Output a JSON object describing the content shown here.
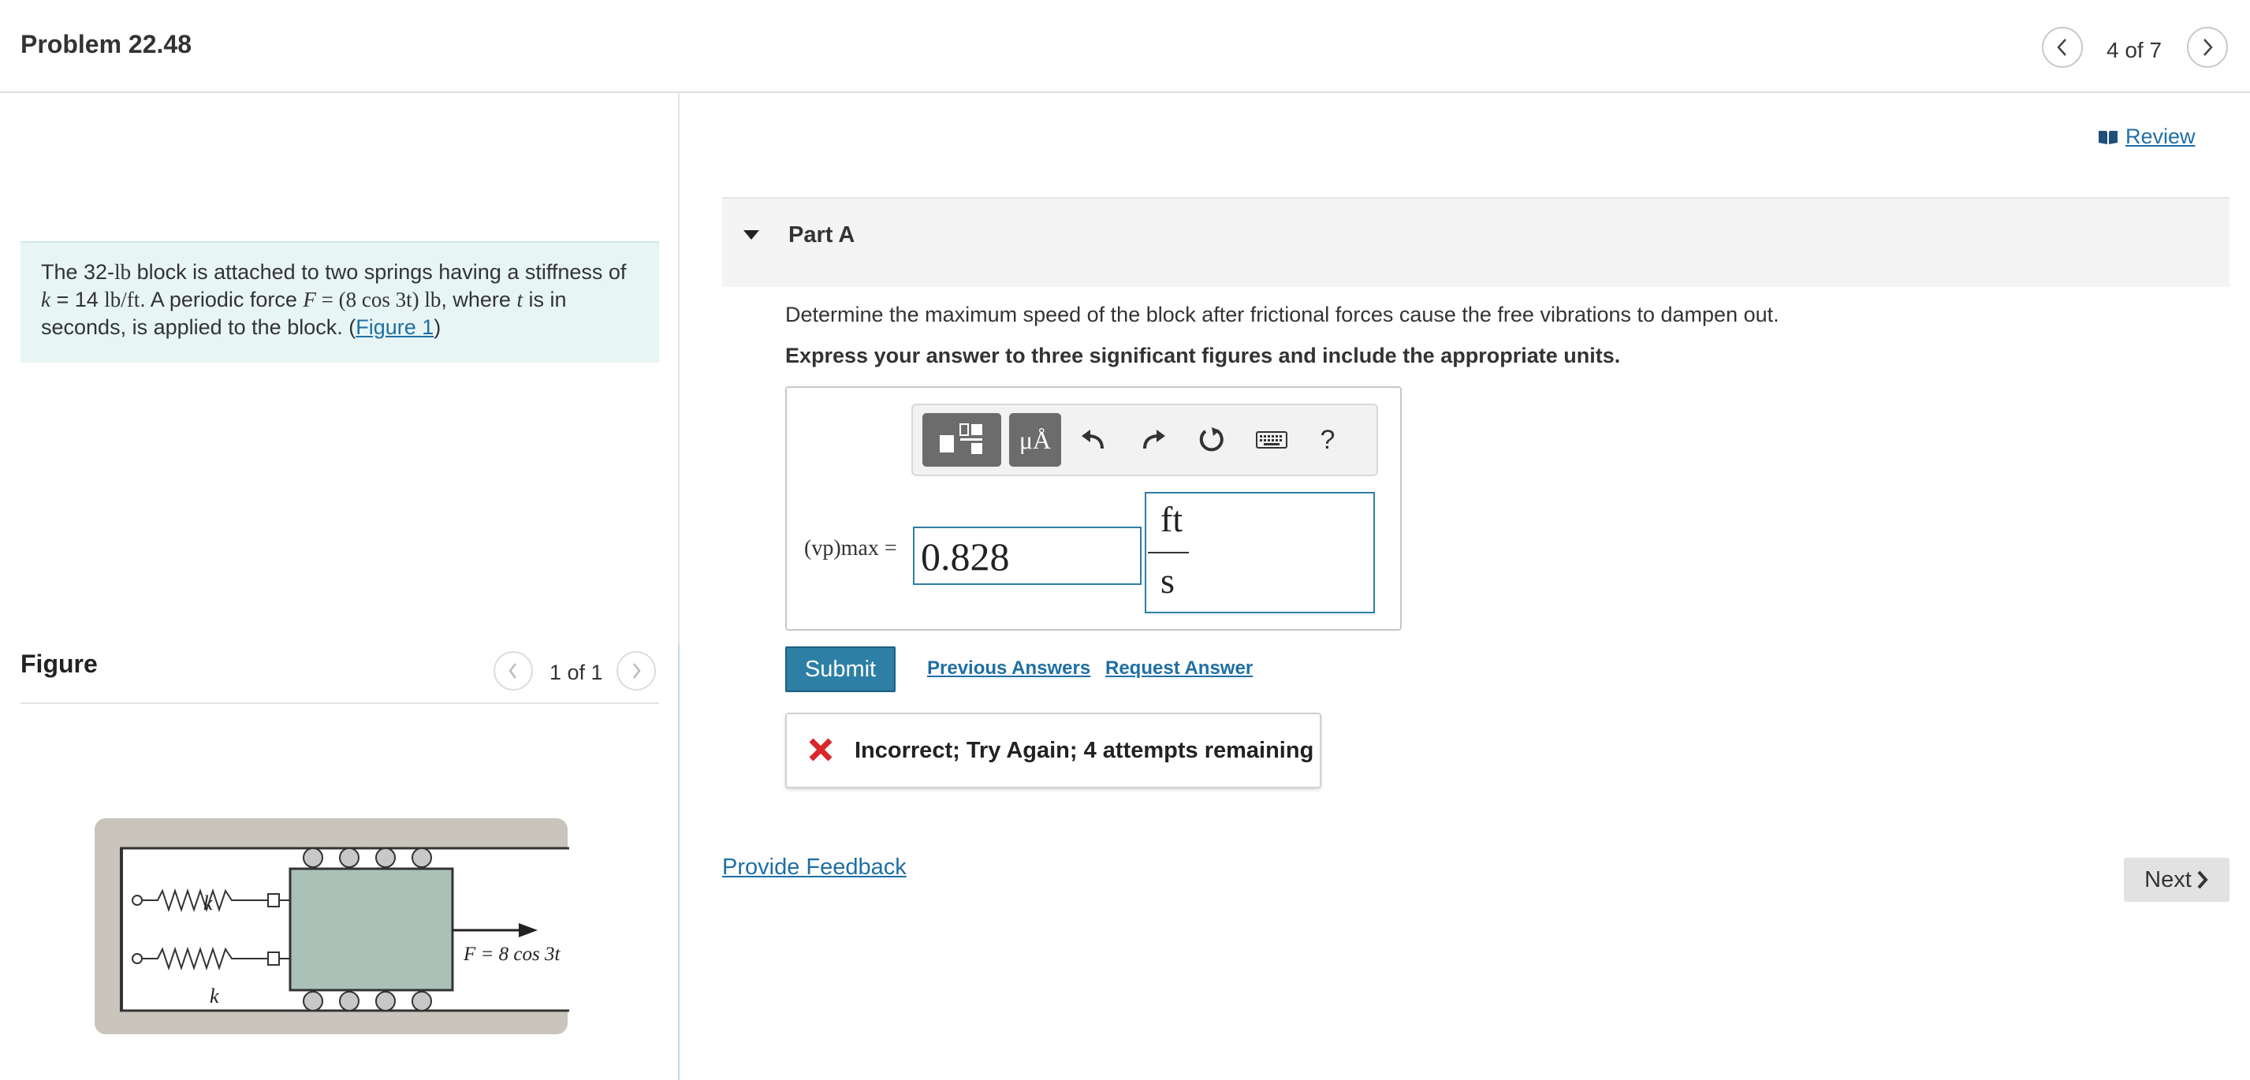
{
  "header": {
    "problem_title": "Problem 22.48",
    "nav_count": "4 of 7"
  },
  "intro": {
    "line1_pre": "The 32-",
    "line1_lb": "lb",
    "line1_post": " block is attached to two springs having a stiffness of",
    "line2_k": "k",
    "line2_eq": " = 14 ",
    "line2_units": "lb/ft",
    "line2_mid": ". A periodic force ",
    "line2_F": "F",
    "line2_expr": " = (8 cos 3t) lb",
    "line2_where": ", where ",
    "line2_t": "t",
    "line2_end": " is in",
    "line3_pre": "seconds, is applied to the block. (",
    "figure_link": "Figure 1",
    "line3_post": ")"
  },
  "figure": {
    "label": "Figure",
    "count": "1 of 1",
    "spring_label_top": "k",
    "spring_label_bottom": "k",
    "force_label": "F = 8 cos 3t"
  },
  "review": {
    "label": "Review"
  },
  "part_a": {
    "title": "Part A",
    "question": "Determine the maximum speed of the block after frictional forces cause the free vibrations to dampen out.",
    "instruction": "Express your answer to three significant figures and include the appropriate units.",
    "toolbar": {
      "units_glyph": "μÅ",
      "help_glyph": "?"
    },
    "variable_label": "(vp)max =",
    "answer_value": "0.828",
    "unit_numerator": "ft",
    "unit_denominator": "s",
    "submit_label": "Submit",
    "previous_answers": "Previous Answers",
    "request_answer": "Request Answer",
    "feedback": "Incorrect; Try Again; 4 attempts remaining"
  },
  "footer": {
    "provide_feedback": "Provide Feedback",
    "next_label": "Next"
  },
  "colors": {
    "accent": "#2d7fa6",
    "link": "#1f6fa5",
    "error": "#d9262b",
    "intro_bg": "#e8f5f5"
  }
}
